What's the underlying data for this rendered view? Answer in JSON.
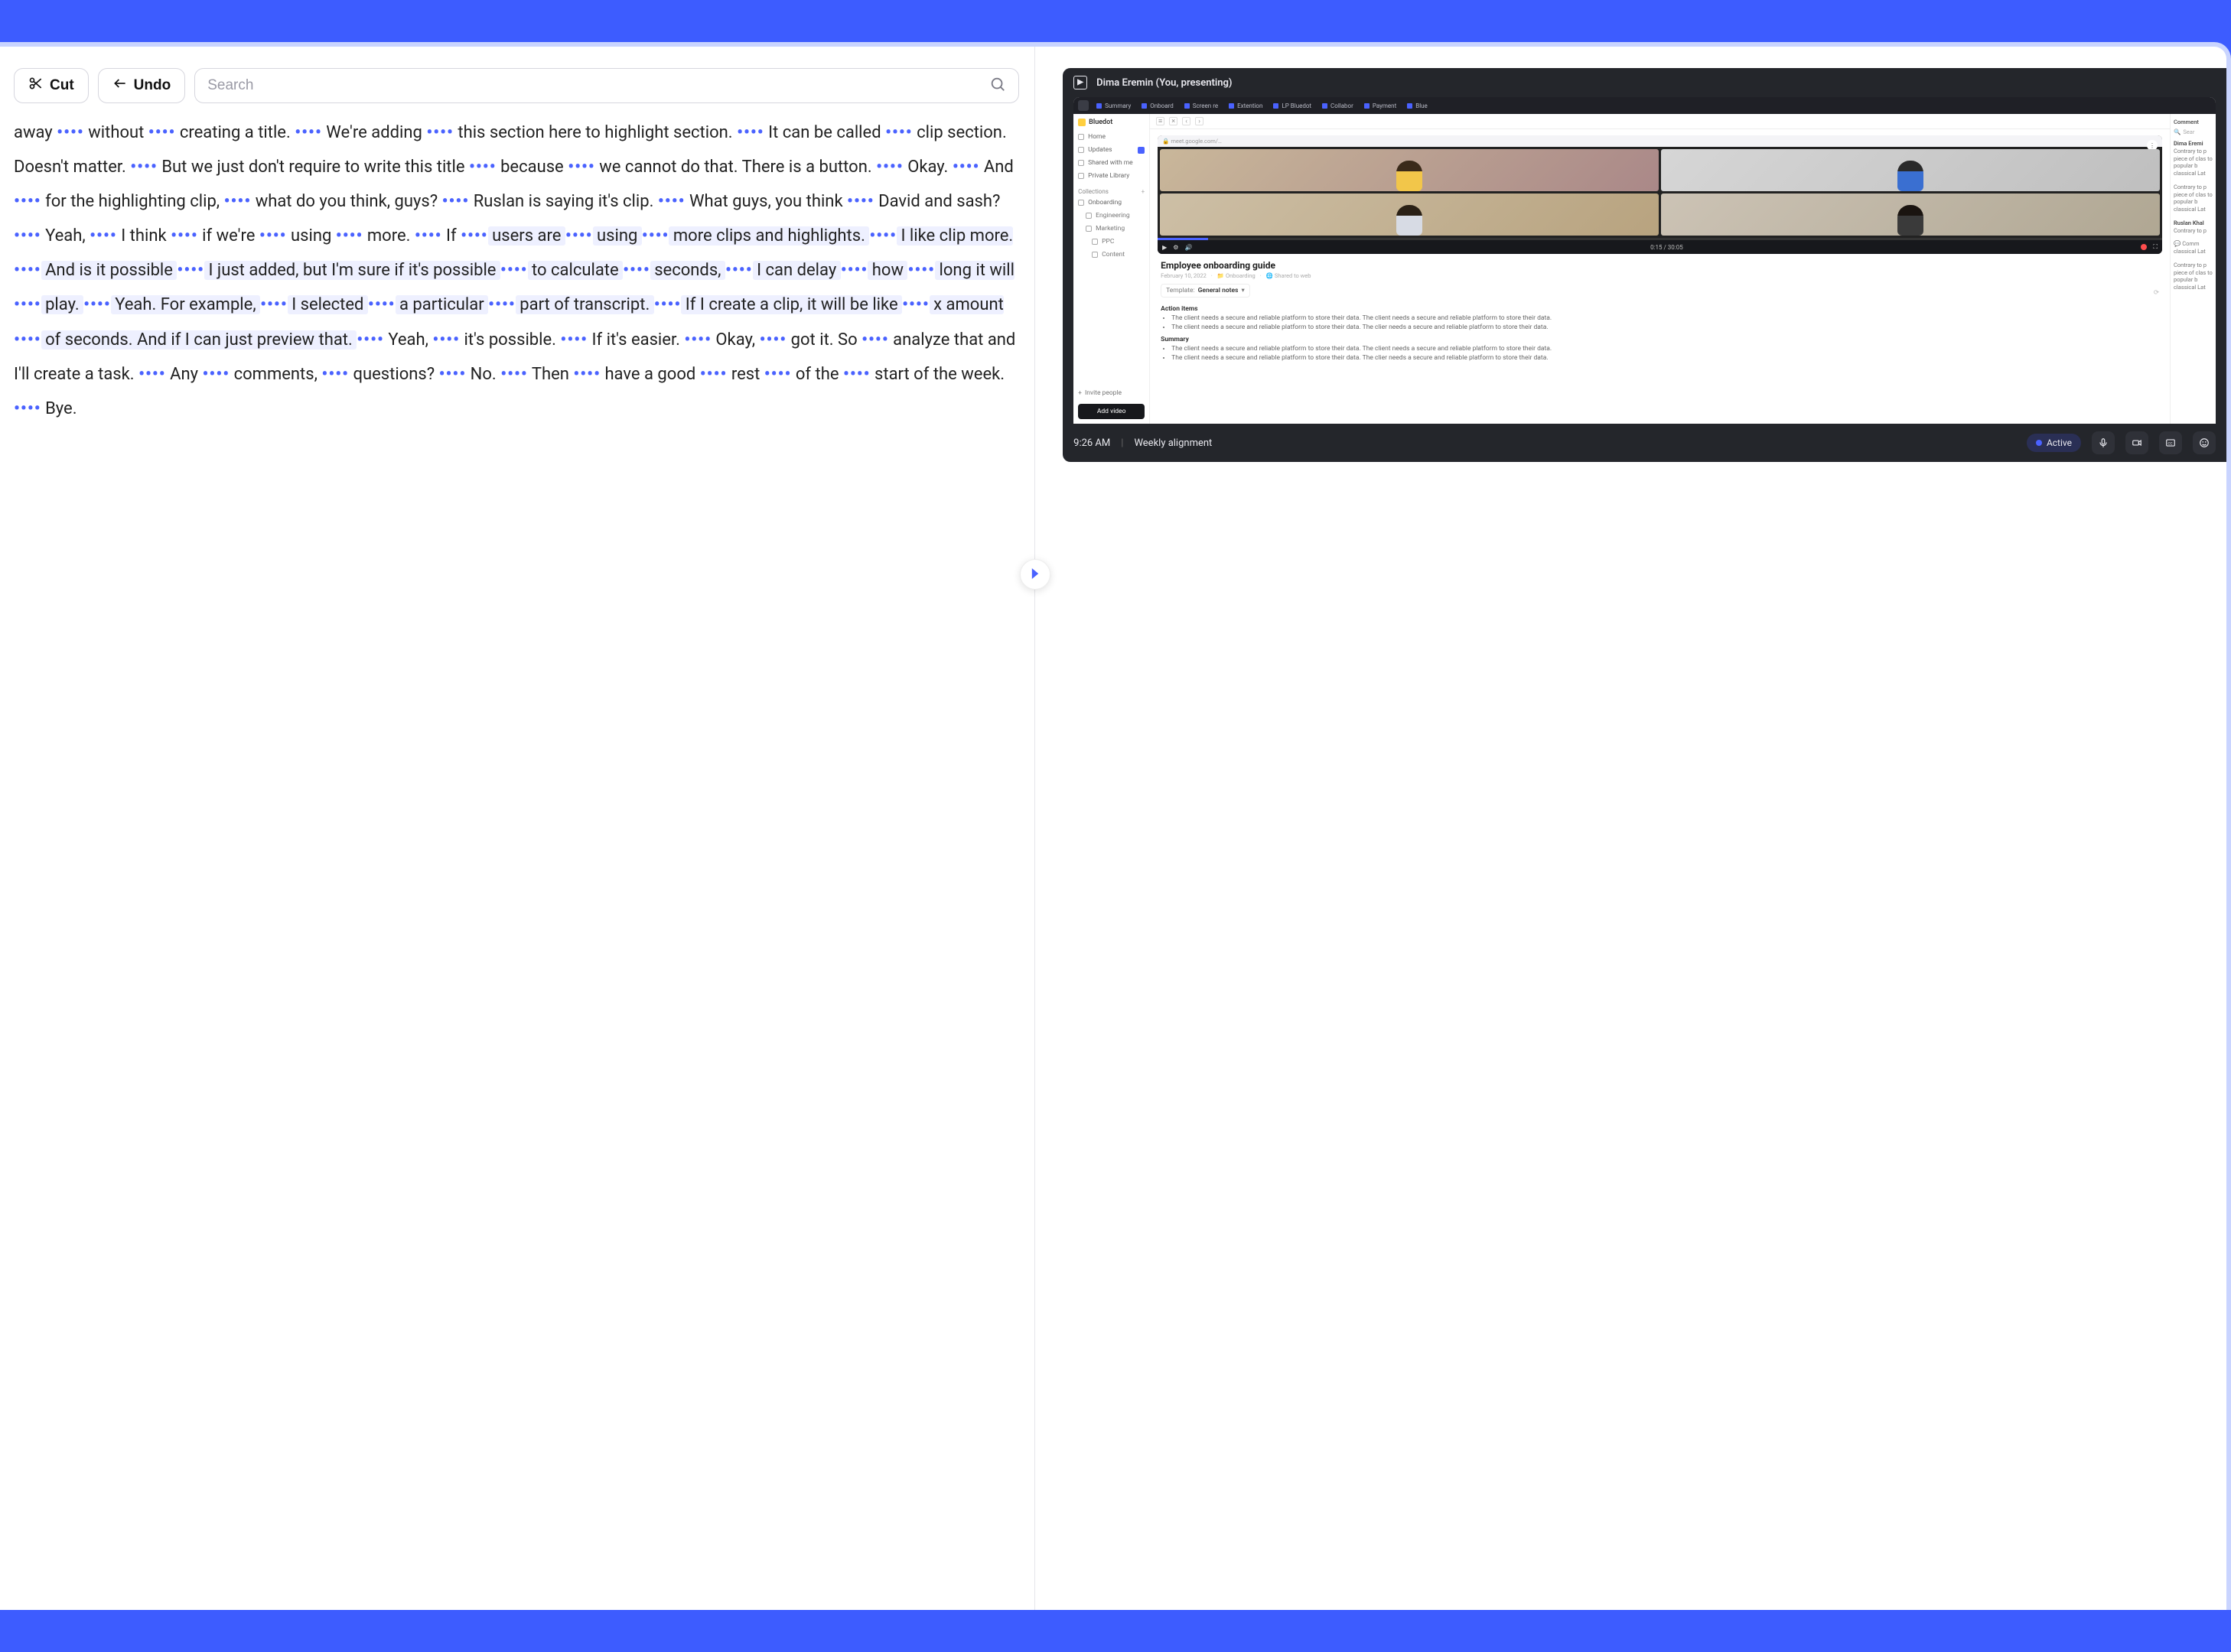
{
  "toolbar": {
    "cut_label": "Cut",
    "undo_label": "Undo",
    "search_placeholder": "Search"
  },
  "transcript": {
    "segments": [
      {
        "t": "away ",
        "h": false
      },
      {
        "dots": true
      },
      {
        "t": " without ",
        "h": false
      },
      {
        "dots": true
      },
      {
        "t": " creating a title. ",
        "h": false
      },
      {
        "dots": true
      },
      {
        "t": " We're adding ",
        "h": false
      },
      {
        "dots": true
      },
      {
        "t": " this section here to highlight section. ",
        "h": false
      },
      {
        "dots": true
      },
      {
        "t": " It can be called ",
        "h": false
      },
      {
        "dots": true
      },
      {
        "t": " clip section. Doesn't matter. ",
        "h": false
      },
      {
        "dots": true
      },
      {
        "t": " But we just don't require to write this title ",
        "h": false
      },
      {
        "dots": true
      },
      {
        "t": " because ",
        "h": false
      },
      {
        "dots": true
      },
      {
        "t": " we cannot do that. There is a button. ",
        "h": false
      },
      {
        "dots": true
      },
      {
        "t": " Okay. ",
        "h": false
      },
      {
        "dots": true
      },
      {
        "t": " And ",
        "h": false
      },
      {
        "dots": true
      },
      {
        "t": " for the highlighting clip, ",
        "h": false
      },
      {
        "dots": true
      },
      {
        "t": " what do you think, guys? ",
        "h": false
      },
      {
        "dots": true
      },
      {
        "t": " Ruslan is saying it's clip. ",
        "h": false
      },
      {
        "dots": true
      },
      {
        "t": " What guys, you think ",
        "h": false
      },
      {
        "dots": true
      },
      {
        "t": " David and sash? ",
        "h": false
      },
      {
        "dots": true
      },
      {
        "t": " Yeah, ",
        "h": false
      },
      {
        "dots": true
      },
      {
        "t": " I think ",
        "h": false
      },
      {
        "dots": true
      },
      {
        "t": " if we're ",
        "h": false
      },
      {
        "dots": true
      },
      {
        "t": " using ",
        "h": false
      },
      {
        "dots": true
      },
      {
        "t": " more. ",
        "h": false
      },
      {
        "dots": true
      },
      {
        "t": " If ",
        "h": false
      },
      {
        "dots": true
      },
      {
        "t": " users are ",
        "h": true
      },
      {
        "dots": true
      },
      {
        "t": " using ",
        "h": true
      },
      {
        "dots": true
      },
      {
        "t": " more clips and highlights. ",
        "h": true
      },
      {
        "dots": true
      },
      {
        "t": " I like clip more. ",
        "h": true
      },
      {
        "dots": true
      },
      {
        "t": " And is it possible ",
        "h": true
      },
      {
        "dots": true
      },
      {
        "t": " I just added, but I'm sure if it's possible ",
        "h": true
      },
      {
        "dots": true
      },
      {
        "t": " to calculate ",
        "h": true
      },
      {
        "dots": true
      },
      {
        "t": " seconds, ",
        "h": true
      },
      {
        "dots": true
      },
      {
        "t": " I can delay ",
        "h": true
      },
      {
        "dots": true
      },
      {
        "t": " how ",
        "h": true
      },
      {
        "dots": true
      },
      {
        "t": " long it will ",
        "h": true
      },
      {
        "dots": true
      },
      {
        "t": " play. ",
        "h": true
      },
      {
        "dots": true
      },
      {
        "t": " Yeah. For example, ",
        "h": true
      },
      {
        "dots": true
      },
      {
        "t": " I selected ",
        "h": true
      },
      {
        "dots": true
      },
      {
        "t": " a particular ",
        "h": true
      },
      {
        "dots": true
      },
      {
        "t": " part of transcript. ",
        "h": true
      },
      {
        "dots": true
      },
      {
        "t": " If I create a clip, it will be like ",
        "h": true
      },
      {
        "dots": true
      },
      {
        "t": " x amount ",
        "h": true
      },
      {
        "dots": true
      },
      {
        "t": " of seconds. And if I can just preview that. ",
        "h": true
      },
      {
        "dots": true
      },
      {
        "t": " Yeah, ",
        "h": false
      },
      {
        "dots": true
      },
      {
        "t": " it's possible. ",
        "h": false
      },
      {
        "dots": true
      },
      {
        "t": " If it's easier. ",
        "h": false
      },
      {
        "dots": true
      },
      {
        "t": " Okay, ",
        "h": false
      },
      {
        "dots": true
      },
      {
        "t": " got it. So ",
        "h": false
      },
      {
        "dots": true
      },
      {
        "t": " analyze that and I'll create a task. ",
        "h": false
      },
      {
        "dots": true
      },
      {
        "t": " Any ",
        "h": false
      },
      {
        "dots": true
      },
      {
        "t": " comments, ",
        "h": false
      },
      {
        "dots": true
      },
      {
        "t": " questions? ",
        "h": false
      },
      {
        "dots": true
      },
      {
        "t": " No. ",
        "h": false
      },
      {
        "dots": true
      },
      {
        "t": " Then ",
        "h": false
      },
      {
        "dots": true
      },
      {
        "t": " have a good ",
        "h": false
      },
      {
        "dots": true
      },
      {
        "t": " rest ",
        "h": false
      },
      {
        "dots": true
      },
      {
        "t": " of the ",
        "h": false
      },
      {
        "dots": true
      },
      {
        "t": " start of the week. ",
        "h": false
      },
      {
        "dots": true
      },
      {
        "t": " Bye.",
        "h": false
      }
    ],
    "dots_glyph": "••••"
  },
  "meeting": {
    "presenter": "Dima Eremin (You, presenting)",
    "time": "9:26 AM",
    "title": "Weekly alignment",
    "active_label": "Active"
  },
  "shared": {
    "brand": "Bluedot",
    "tabs": [
      "Summary",
      "Onboard",
      "Screen re",
      "Extention",
      "LP Bluedot",
      "Collabor",
      "Payment",
      "Blue"
    ],
    "nav": {
      "home": "Home",
      "updates": "Updates",
      "shared": "Shared with me",
      "private": "Private Library"
    },
    "collections_header": "Collections",
    "collections": [
      "Onboarding",
      "Engineering",
      "Marketing"
    ],
    "sub_items": [
      "PPC",
      "Content"
    ],
    "invite": "Invite people",
    "add_video": "Add video",
    "video": {
      "time": "0:15 / 30:05"
    },
    "doc": {
      "title": "Employee onboarding guide",
      "date": "February 10, 2022",
      "coll": "Onboarding",
      "shared": "Shared to web",
      "template_label": "Template:",
      "template_value": "General notes",
      "action_header": "Action items",
      "summary_header": "Summary",
      "bullet1": "The client needs a secure and reliable platform to store their data. The client needs a secure and reliable platform to store their data.",
      "bullet2": "The client needs a secure and reliable platform to store their data. The clier needs a secure and reliable platform to store their data."
    },
    "comments": {
      "header": "Comment",
      "search": "Sear",
      "c1_name": "Dima Eremi",
      "c1_body": "Contrary to p piece of clas to popular b classical Lat",
      "c2_body": "Contrary to p piece of clas to popular b classical Lat",
      "c3_name": "Ruslan Khal",
      "c3_body": "Contrary to p",
      "c4_link": "Comm",
      "c4_sub": "classical Lat",
      "c5_body": "Contrary to p piece of clas to popular b classical Lat"
    }
  }
}
